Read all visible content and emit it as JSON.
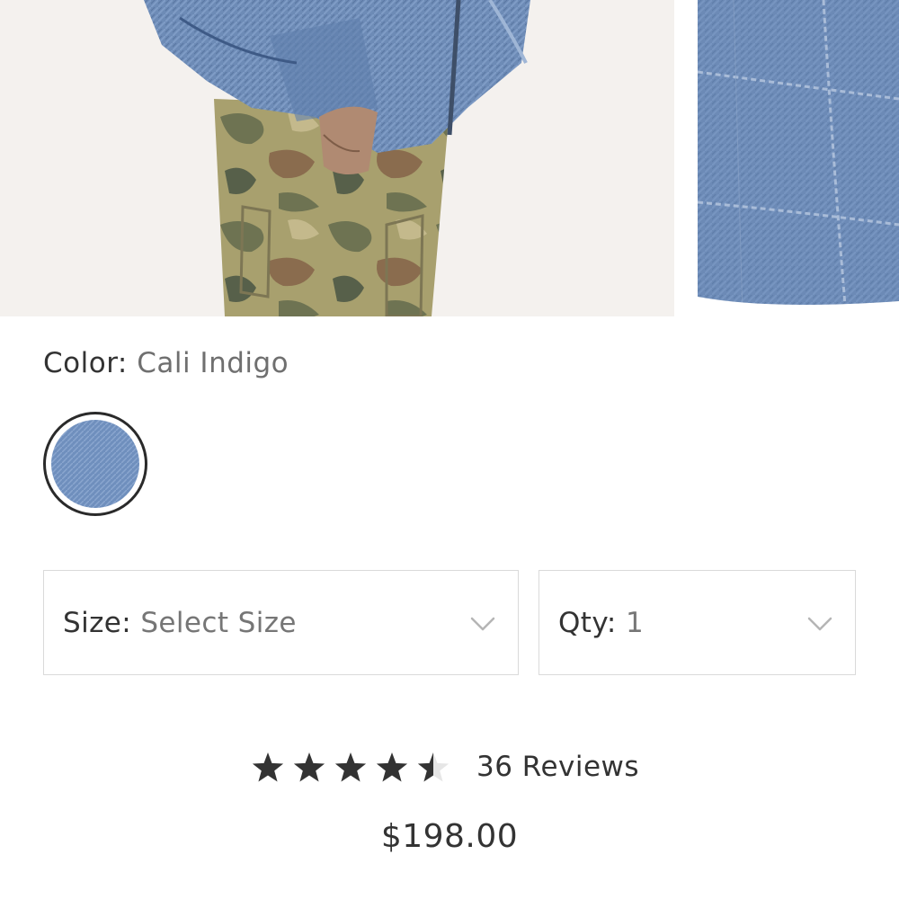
{
  "gallery": {
    "images": [
      {
        "alt": "Model wearing quilted denim jacket with camo pants"
      },
      {
        "alt": "Close-up of quilted denim texture"
      }
    ]
  },
  "color": {
    "label": "Color:",
    "value": "Cali Indigo",
    "swatch_color": "#6f8fbd"
  },
  "size_select": {
    "label": "Size:",
    "value": "Select Size"
  },
  "qty_select": {
    "label": "Qty:",
    "value": "1"
  },
  "rating": {
    "stars": 4.5,
    "max": 5,
    "reviews_label": "36 Reviews"
  },
  "price": "$198.00",
  "colors": {
    "text": "#333333",
    "muted": "#767676",
    "border": "#dadada",
    "denim": "#6f8fbd"
  }
}
